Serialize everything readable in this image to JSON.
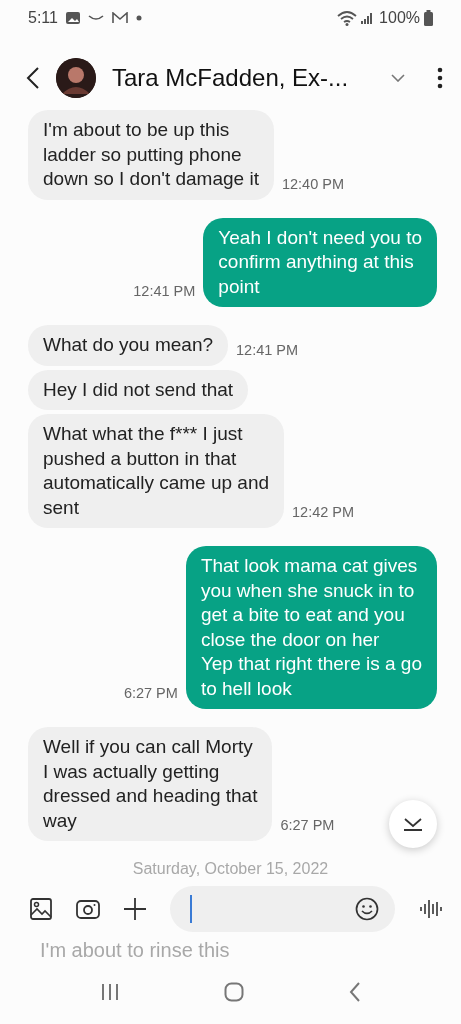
{
  "status_bar": {
    "time": "5:11",
    "battery": "100%"
  },
  "header": {
    "contact": "Tara McFadden, Ex-..."
  },
  "messages": [
    {
      "kind": "in",
      "lines": [
        "I'm about to be up this",
        "ladder so putting phone",
        "down so I don't damage it"
      ],
      "time": "12:40 PM"
    },
    {
      "kind": "out",
      "lines": [
        "Yeah I don't need you to",
        "confirm anything at this",
        "point"
      ],
      "time": "12:41 PM"
    },
    {
      "kind": "in",
      "lines": [
        "What do you mean?"
      ],
      "time": "12:41 PM"
    },
    {
      "kind": "in",
      "lines": [
        "Hey I did not send that"
      ]
    },
    {
      "kind": "in",
      "lines": [
        "What what the f*** I just",
        "pushed a button in that",
        "automatically came up and",
        "sent"
      ],
      "time": "12:42 PM"
    },
    {
      "kind": "out",
      "lines": [
        "That look mama cat gives",
        "you when she snuck in to",
        "get a bite to eat and you",
        "close the door on her",
        "Yep that right there is a go",
        "to hell look"
      ],
      "time": "6:27 PM"
    },
    {
      "kind": "in",
      "lines": [
        "Well if you can call Morty",
        "I was actually getting",
        "dressed and heading that",
        "way"
      ],
      "time": "6:27 PM"
    }
  ],
  "date_divider": "Saturday, October 15, 2022",
  "next_message_preview": "I'm about to rinse this"
}
